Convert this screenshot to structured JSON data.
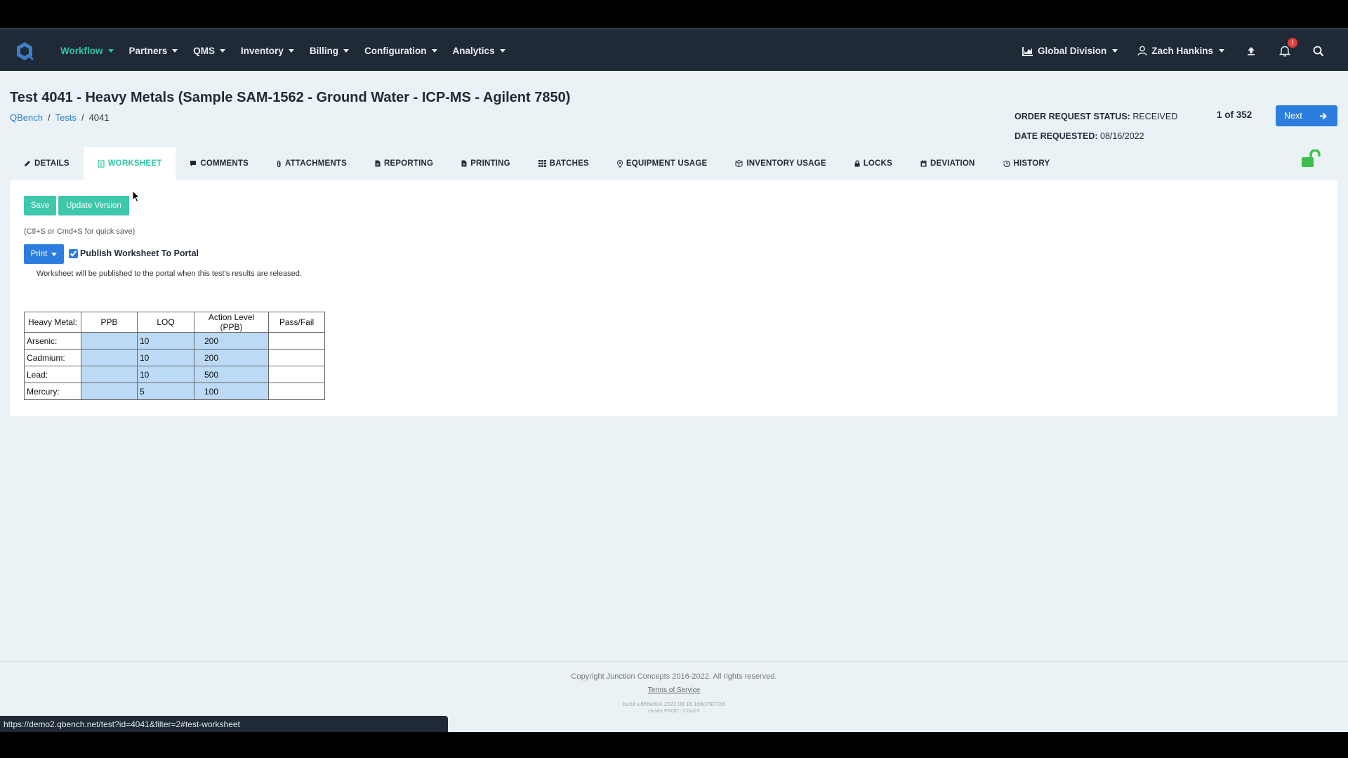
{
  "nav": {
    "items": [
      {
        "label": "Workflow",
        "active": true
      },
      {
        "label": "Partners",
        "active": false
      },
      {
        "label": "QMS",
        "active": false
      },
      {
        "label": "Inventory",
        "active": false
      },
      {
        "label": "Billing",
        "active": false
      },
      {
        "label": "Configuration",
        "active": false
      },
      {
        "label": "Analytics",
        "active": false
      }
    ],
    "division": "Global Division",
    "user": "Zach Hankins",
    "notification_count": "!",
    "icons": [
      "logo-icon",
      "chart-icon",
      "user-icon",
      "upload-icon",
      "bell-icon",
      "search-icon"
    ]
  },
  "header": {
    "title": "Test 4041 - Heavy Metals (Sample SAM-1562 - Ground Water - ICP-MS - Agilent 7850)",
    "breadcrumb": [
      "QBench",
      "Tests",
      "4041"
    ],
    "order_status_label": "ORDER REQUEST STATUS:",
    "order_status_value": "RECEIVED",
    "date_label": "DATE REQUESTED:",
    "date_value": "08/16/2022",
    "pager": "1 of 352",
    "next_label": "Next"
  },
  "tabs": [
    {
      "label": "DETAILS",
      "icon": "pencil-icon"
    },
    {
      "label": "WORKSHEET",
      "icon": "worksheet-icon",
      "active": true
    },
    {
      "label": "COMMENTS",
      "icon": "comment-icon"
    },
    {
      "label": "ATTACHMENTS",
      "icon": "paperclip-icon"
    },
    {
      "label": "REPORTING",
      "icon": "file-icon"
    },
    {
      "label": "PRINTING",
      "icon": "file-icon"
    },
    {
      "label": "BATCHES",
      "icon": "grid-icon"
    },
    {
      "label": "EQUIPMENT USAGE",
      "icon": "map-pin-icon"
    },
    {
      "label": "INVENTORY USAGE",
      "icon": "box-icon"
    },
    {
      "label": "LOCKS",
      "icon": "lock-icon"
    },
    {
      "label": "DEVIATION",
      "icon": "calendar-icon"
    },
    {
      "label": "HISTORY",
      "icon": "history-icon"
    }
  ],
  "worksheet": {
    "save_label": "Save",
    "update_label": "Update Version",
    "hint": "(Ctl+S or Cmd+S for quick save)",
    "print_label": "Print",
    "publish_label": "Publish Worksheet To Portal",
    "publish_checked": true,
    "publish_note": "Worksheet will be published to the portal when this test's results are released.",
    "table": {
      "headers": [
        "Heavy Metal:",
        "PPB",
        "LOQ",
        "Action Level (PPB)",
        "Pass/Fail"
      ],
      "rows": [
        {
          "metal": "Arsenic:",
          "ppb": "",
          "loq": "10",
          "action": "200",
          "pass": ""
        },
        {
          "metal": "Cadmium:",
          "ppb": "",
          "loq": "10",
          "action": "200",
          "pass": ""
        },
        {
          "metal": "Lead:",
          "ppb": "",
          "loq": "10",
          "action": "500",
          "pass": ""
        },
        {
          "metal": "Mercury:",
          "ppb": "",
          "loq": "5",
          "action": "100",
          "pass": ""
        }
      ]
    }
  },
  "footer": {
    "copyright": "Copyright Junction Concepts 2016-2022. All rights reserved.",
    "terms": "Terms of Service",
    "build": "build v.866e6d4.2022.08.18.1660790728",
    "cluster": "cluster PROD - Cloud 5"
  },
  "status_url": "https://demo2.qbench.net/test?id=4041&filter=2#test-worksheet",
  "colors": {
    "navbar": "#1f2a36",
    "accent_green": "#2ec4a4",
    "primary_blue": "#2c7de0",
    "cell_blue": "#bcdaf6",
    "page_bg": "#eaf2f6"
  }
}
